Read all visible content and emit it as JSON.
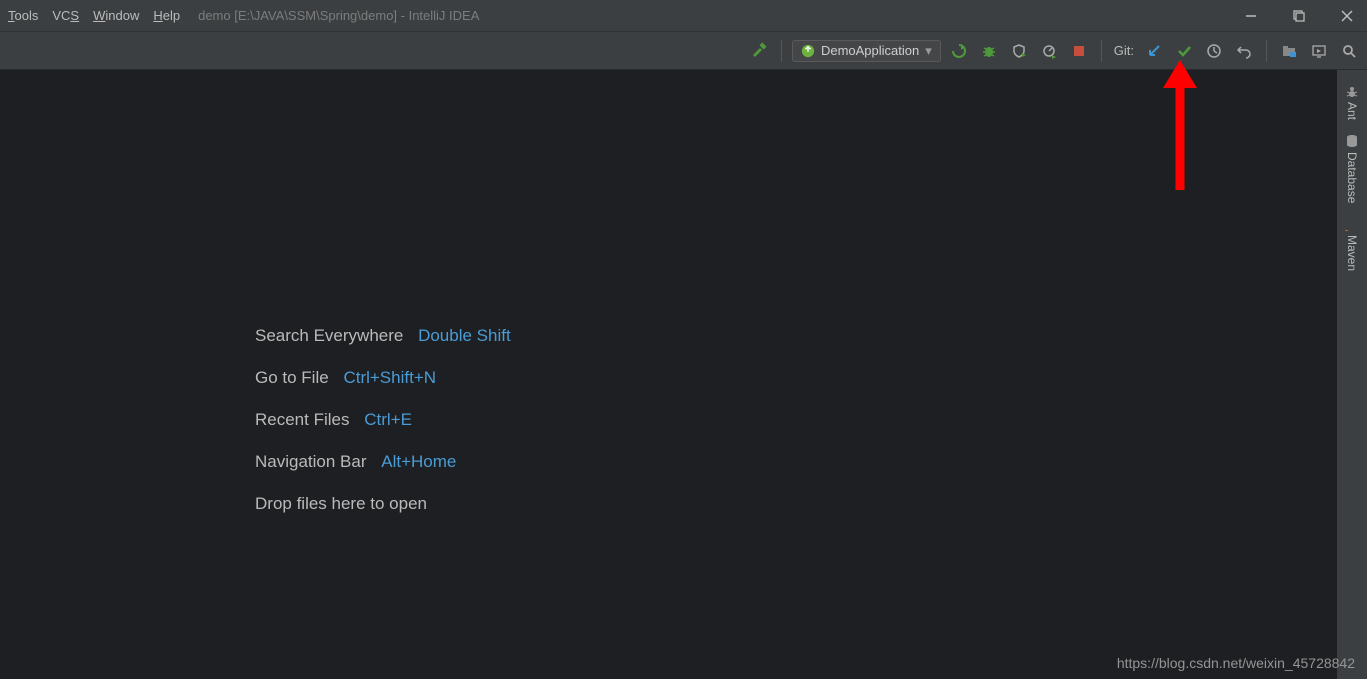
{
  "menu": {
    "tools": "Tools",
    "vcs": "VCS",
    "window": "Window",
    "help": "Help"
  },
  "title": "demo [E:\\JAVA\\SSM\\Spring\\demo] - IntelliJ IDEA",
  "toolbar": {
    "run_config": "DemoApplication",
    "git_label": "Git:"
  },
  "hints": [
    {
      "label": "Search Everywhere",
      "shortcut": "Double Shift"
    },
    {
      "label": "Go to File",
      "shortcut": "Ctrl+Shift+N"
    },
    {
      "label": "Recent Files",
      "shortcut": "Ctrl+E"
    },
    {
      "label": "Navigation Bar",
      "shortcut": "Alt+Home"
    },
    {
      "label": "Drop files here to open",
      "shortcut": ""
    }
  ],
  "rightStrip": {
    "ant": "Ant",
    "database": "Database",
    "maven": "Maven"
  },
  "watermark": "https://blog.csdn.net/weixin_45728842"
}
